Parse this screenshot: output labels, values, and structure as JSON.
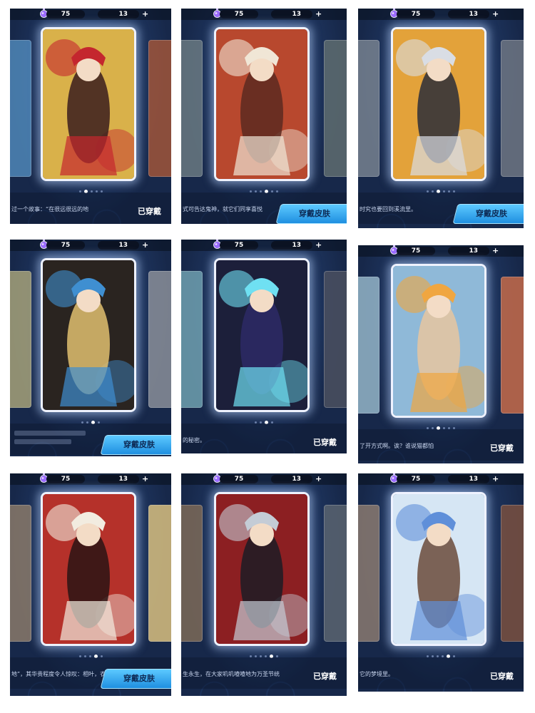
{
  "panels": [
    {
      "coins": "75",
      "gems": "13",
      "desc": "过一个故事：“在很远很远的地",
      "action": "已穿戴",
      "action_type": "equipped",
      "active_dot": 2,
      "dots": 5,
      "art": {
        "bg": "#d9b14a",
        "accent": "#c4262e",
        "fig": "#3a1d1d",
        "side_l": "#4f87b8",
        "side_r": "#a0553a"
      }
    },
    {
      "coins": "75",
      "gems": "13",
      "desc": "式可告达鬼神，就它们同享喜悦",
      "action": "穿戴皮肤",
      "action_type": "button",
      "active_dot": 4,
      "dots": 6,
      "art": {
        "bg": "#b8482e",
        "accent": "#f0e6d6",
        "fig": "#5c2a20",
        "side_l": "#6a7a82",
        "side_r": "#5f6d70"
      }
    },
    {
      "coins": "75",
      "gems": "13",
      "desc": "时究也要回到溪流里。",
      "action": "穿戴皮肤",
      "action_type": "button",
      "active_dot": 3,
      "dots": 6,
      "art": {
        "bg": "#e3a23a",
        "accent": "#d9dde4",
        "fig": "#2b2e3a",
        "side_l": "#778290",
        "side_r": "#6e7683"
      }
    },
    {
      "coins": "75",
      "gems": "13",
      "desc": "",
      "action": "穿戴皮肤",
      "action_type": "button",
      "active_dot": 3,
      "dots": 4,
      "art": {
        "bg": "#2a2420",
        "accent": "#3f8fd1",
        "fig": "#e0c070",
        "side_l": "#a6a27a",
        "side_r": "#8a8f99"
      }
    },
    {
      "coins": "75",
      "gems": "13",
      "desc": "的秘密。",
      "action": "已穿戴",
      "action_type": "equipped",
      "active_dot": 3,
      "dots": 4,
      "art": {
        "bg": "#1c1f3a",
        "accent": "#6fe0f2",
        "fig": "#2d2a66",
        "side_l": "#6fa0b0",
        "side_r": "#4b5060"
      }
    },
    {
      "coins": "75",
      "gems": "13",
      "desc": "了开方式啊。诶？谁说猫都怕",
      "action": "已穿戴",
      "action_type": "equipped",
      "active_dot": 3,
      "dots": 6,
      "art": {
        "bg": "#8fb9d8",
        "accent": "#f0a640",
        "fig": "#e8c6a0",
        "side_l": "#94b5c8",
        "side_r": "#c66b4a"
      }
    },
    {
      "coins": "75",
      "gems": "13",
      "desc": "地”，其华贵程度令人惊叹：相叶，衣裳漏风处已纪好厚厚",
      "action": "穿戴皮肤",
      "action_type": "button",
      "active_dot": 4,
      "dots": 5,
      "art": {
        "bg": "#b5312a",
        "accent": "#f2ece0",
        "fig": "#2a1414",
        "side_l": "#8a7a6a",
        "side_r": "#d9c080"
      }
    },
    {
      "coins": "75",
      "gems": "13",
      "desc": "生永生，在大家叽叽喳喳地为万圣节统",
      "action": "已穿戴",
      "action_type": "equipped",
      "active_dot": 5,
      "dots": 6,
      "art": {
        "bg": "#8c1f22",
        "accent": "#c4ccd6",
        "fig": "#1c1c24",
        "side_l": "#7d6a58",
        "side_r": "#5a6470"
      }
    },
    {
      "coins": "75",
      "gems": "13",
      "desc": "它的梦境里。",
      "action": "已穿戴",
      "action_type": "equipped",
      "active_dot": 5,
      "dots": 6,
      "art": {
        "bg": "#d6e6f4",
        "accent": "#5f8fd9",
        "fig": "#6b4a3a",
        "side_l": "#8a7a70",
        "side_r": "#7a5040"
      }
    }
  ]
}
